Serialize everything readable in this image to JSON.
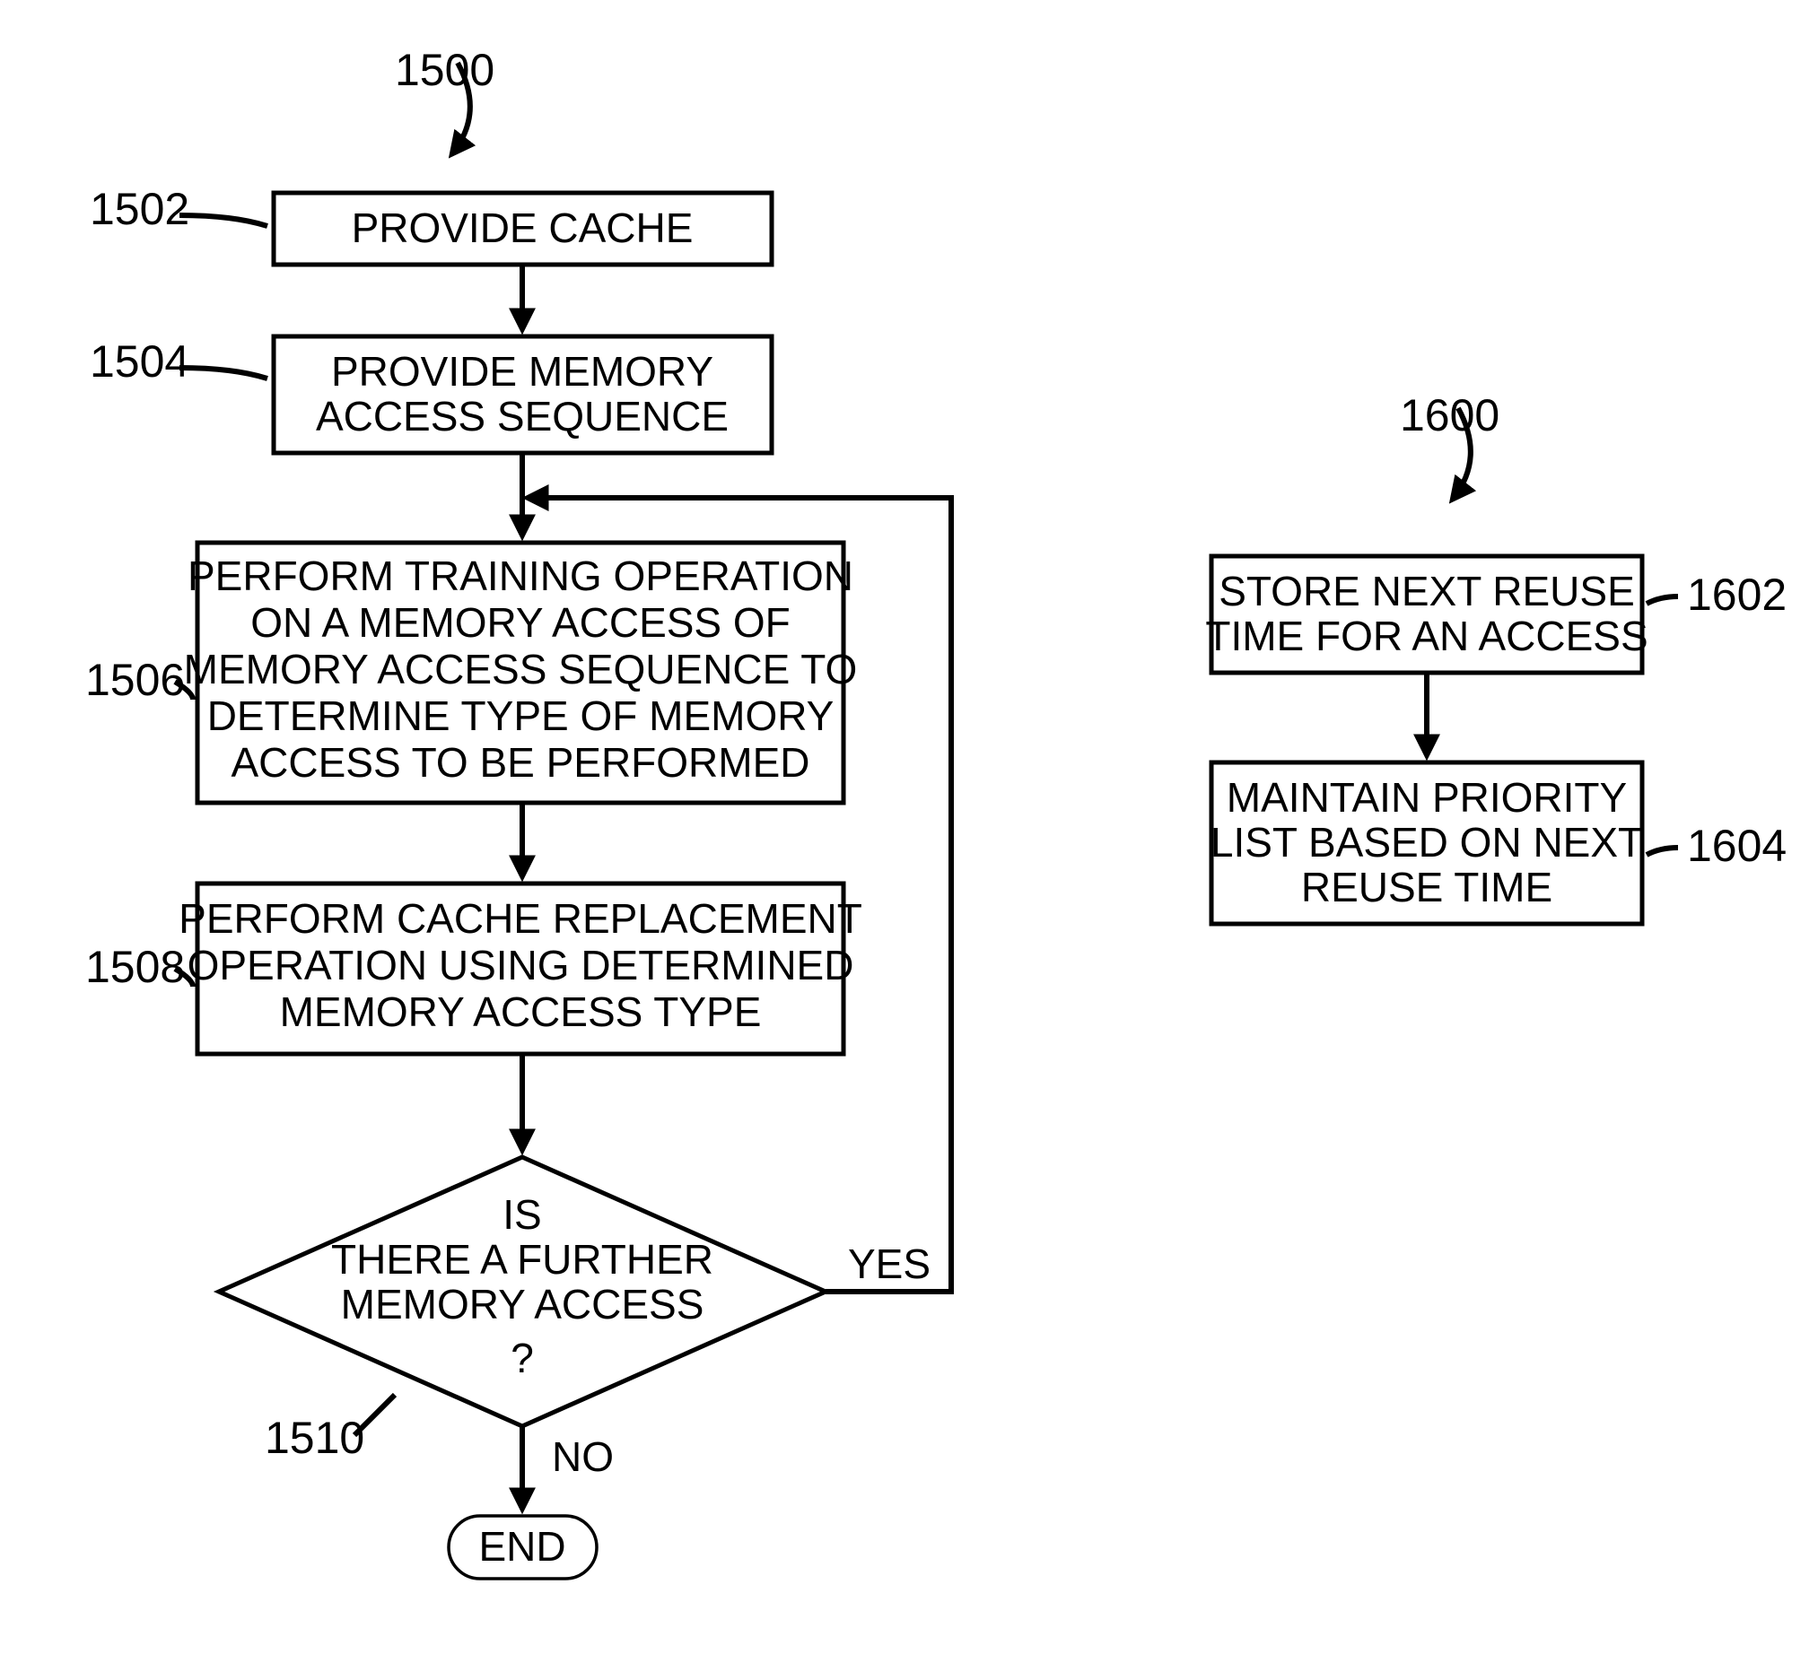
{
  "diagram1500": {
    "title_ref": "1500",
    "boxes": {
      "1502": {
        "ref": "1502",
        "lines": [
          "PROVIDE CACHE"
        ]
      },
      "1504": {
        "ref": "1504",
        "lines": [
          "PROVIDE MEMORY",
          "ACCESS SEQUENCE"
        ]
      },
      "1506": {
        "ref": "1506",
        "lines": [
          "PERFORM  TRAINING OPERATION",
          "ON A MEMORY ACCESS OF",
          "MEMORY ACCESS SEQUENCE TO",
          "DETERMINE TYPE OF MEMORY",
          "ACCESS TO BE PERFORMED"
        ]
      },
      "1508": {
        "ref": "1508",
        "lines": [
          "PERFORM CACHE REPLACEMENT",
          "OPERATION USING DETERMINED",
          "MEMORY ACCESS TYPE"
        ]
      },
      "1510": {
        "ref": "1510",
        "lines": [
          "IS",
          "THERE A FURTHER",
          "MEMORY ACCESS",
          "?"
        ]
      }
    },
    "end": "END",
    "yes": "YES",
    "no": "NO"
  },
  "diagram1600": {
    "title_ref": "1600",
    "boxes": {
      "1602": {
        "ref": "1602",
        "lines": [
          "STORE NEXT REUSE",
          "TIME FOR AN ACCESS"
        ]
      },
      "1604": {
        "ref": "1604",
        "lines": [
          "MAINTAIN PRIORITY",
          "LIST BASED ON NEXT",
          "REUSE TIME"
        ]
      }
    }
  }
}
